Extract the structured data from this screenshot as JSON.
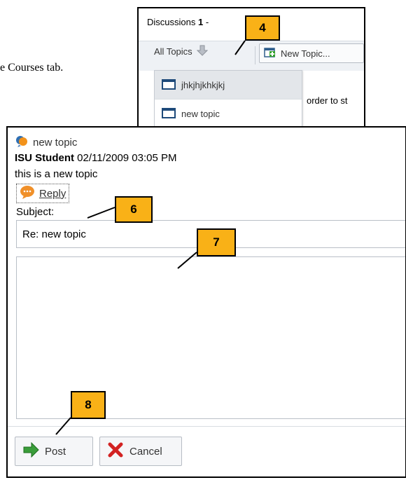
{
  "instruction": {
    "partial_text": "e Courses tab."
  },
  "discussions": {
    "header_label": "Discussions",
    "header_count": "1",
    "header_suffix": " -",
    "all_topics_label": "All Topics",
    "new_topic_label": "New Topic...",
    "menu_items": [
      "jhkjhjkhkjkj",
      "new topic"
    ],
    "side_text": "order to st"
  },
  "post_view": {
    "topic_title": "new topic",
    "author": "ISU Student",
    "timestamp": "02/11/2009 03:05 PM",
    "body_text": "this is a new topic",
    "reply_label": "Reply",
    "subject_label": "Subject:",
    "subject_value": "Re: new topic",
    "post_label": "Post",
    "cancel_label": "Cancel"
  },
  "callouts": {
    "c4": "4",
    "c6": "6",
    "c7": "7",
    "c8": "8"
  },
  "colors": {
    "callout": "#f9b117",
    "post_arrow": "#3a9d3a",
    "cancel_x": "#d22222"
  },
  "icons": [
    "folder-icon",
    "down-arrow-icon",
    "new-topic-icon",
    "discussion-bubble-icon",
    "reply-bubble-icon",
    "post-arrow-icon",
    "cancel-x-icon"
  ]
}
